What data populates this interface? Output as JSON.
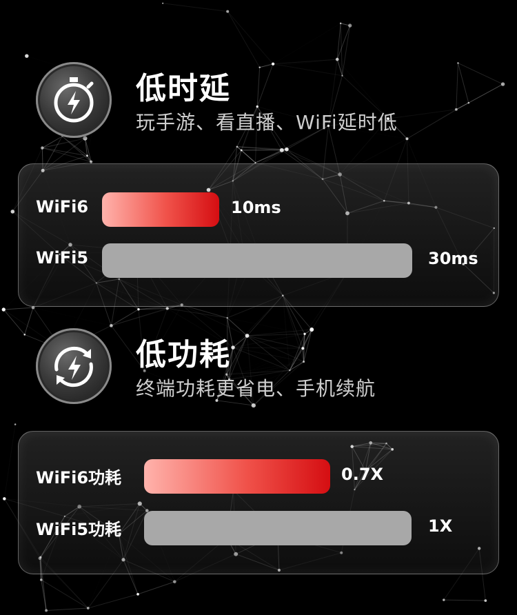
{
  "latency": {
    "icon": "stopwatch-lightning-icon",
    "title": "低时延",
    "subtitle": "玩手游、看直播、WiFi延时低",
    "rows": [
      {
        "label": "WiFi6",
        "value": "10ms",
        "color": "#e8232a"
      },
      {
        "label": "WiFi5",
        "value": "30ms",
        "color": "#a8a8a8"
      }
    ]
  },
  "power": {
    "icon": "recycle-lightning-icon",
    "title": "低功耗",
    "subtitle": "终端功耗更省电、手机续航",
    "rows": [
      {
        "label": "WiFi6功耗",
        "value": "0.7X",
        "color": "#e8232a"
      },
      {
        "label": "WiFi5功耗",
        "value": "1X",
        "color": "#a8a8a8"
      }
    ]
  }
}
